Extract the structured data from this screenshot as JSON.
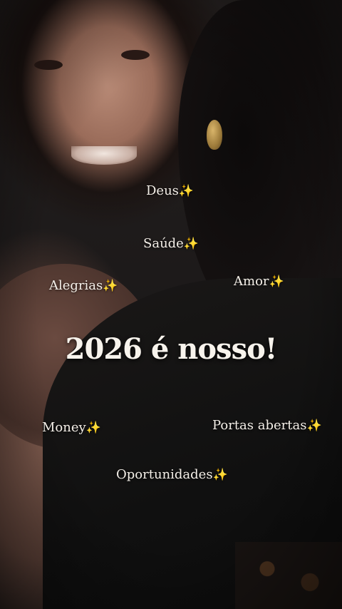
{
  "words": {
    "deus": "Deus",
    "saude": "Saúde",
    "alegrias": "Alegrias",
    "amor": "Amor",
    "money": "Money",
    "portas": "Portas abertas",
    "oportunidades": "Oportunidades"
  },
  "sparkle": "✨",
  "title": "2026 é nosso!",
  "colors": {
    "text": "#f4efe8",
    "sparkle": "#f6cf4a"
  }
}
